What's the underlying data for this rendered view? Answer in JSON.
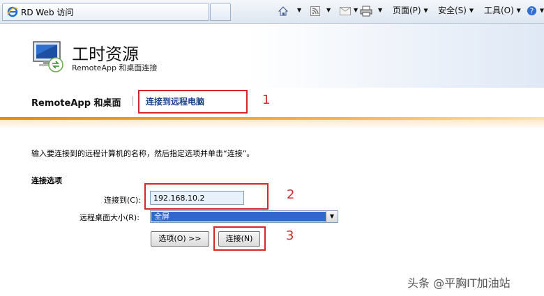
{
  "browser": {
    "tab_title": "RD Web 访问",
    "menu": {
      "page": "页面(P)",
      "safety": "安全(S)",
      "tools": "工具(O)"
    }
  },
  "header": {
    "title": "工时资源",
    "subtitle": "RemoteApp 和桌面连接"
  },
  "nav": {
    "home": "RemoteApp 和桌面",
    "connect": "连接到远程电脑"
  },
  "main": {
    "instruction": "输入要连接到的远程计算机的名称，然后指定选项并单击“连接”。",
    "section_title": "连接选项",
    "connect_to_label": "连接到(C):",
    "connect_to_value": "192.168.10.2",
    "screen_size_label": "远程桌面大小(R):",
    "screen_size_value": "全屏",
    "options_button": "选项(O) >>",
    "connect_button": "连接(N)"
  },
  "annotations": [
    "1",
    "2",
    "3"
  ],
  "watermark": "头条 @平胸IT加油站",
  "colors": {
    "accent_orange": "#e8890c",
    "annotation_red": "#d6262a",
    "link_blue": "#1a3f8a",
    "selection_blue": "#3366cc"
  }
}
